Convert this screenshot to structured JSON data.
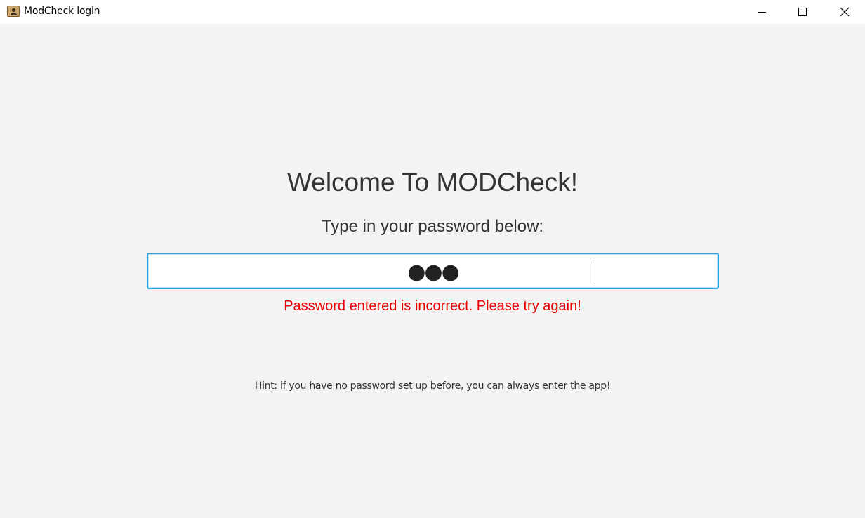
{
  "window": {
    "title": "ModCheck login",
    "icon": "contact-book-icon",
    "controls": {
      "minimize_icon": "minimize-icon",
      "maximize_icon": "maximize-icon",
      "close_icon": "close-icon",
      "close_glyph": "✕"
    }
  },
  "login": {
    "welcome": "Welcome To MODCheck!",
    "prompt": "Type in your password below:",
    "password_value": "●●●",
    "error_message": "Password entered is incorrect. Please try again!",
    "hint": "Hint: if you have no password set up before, you can always enter the app!"
  },
  "colors": {
    "accent_focus": "#2ea3dd",
    "error": "#e60000",
    "text": "#333333",
    "background": "#f3f3f3"
  }
}
